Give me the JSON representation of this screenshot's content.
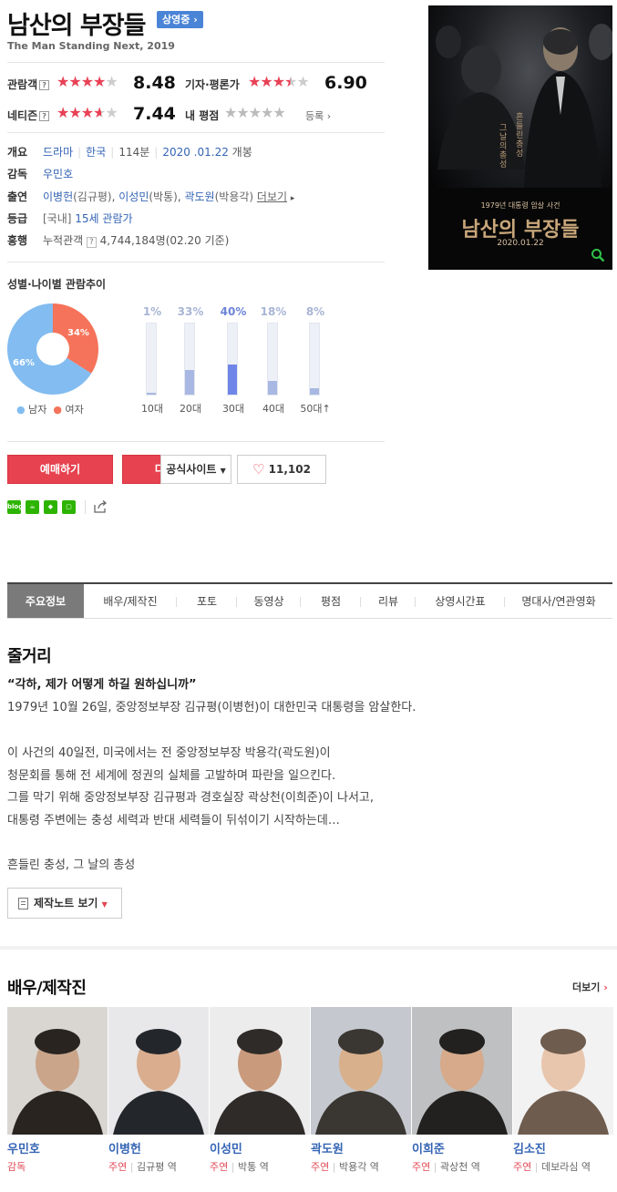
{
  "header": {
    "title": "남산의 부장들",
    "status_badge": "상영중",
    "subtitle": "The Man Standing Next, 2019"
  },
  "ratings": {
    "audience": {
      "label": "관람객",
      "help": "?",
      "stars": 4.2,
      "score": "8.48"
    },
    "critics": {
      "label": "기자·평론가",
      "stars": 3.5,
      "score": "6.90"
    },
    "netizen": {
      "label": "네티즌",
      "help": "?",
      "stars": 3.7,
      "score": "7.44"
    },
    "mine": {
      "label": "내 평점",
      "register": "등록"
    }
  },
  "info": {
    "overview_label": "개요",
    "genre": "드라마",
    "country": "한국",
    "runtime": "114분",
    "release_date": "2020 .01.22",
    "release_suffix": "개봉",
    "director_label": "감독",
    "director": "우민호",
    "cast_label": "출연",
    "cast1": "이병헌",
    "cast1_role": "(김규평)",
    "cast2": "이성민",
    "cast2_role": "(박통)",
    "cast3": "곽도원",
    "cast3_role": "(박용각)",
    "more": "더보기",
    "rating_label": "등급",
    "rating_prefix": "[국내]",
    "rating": "15세 관람가",
    "boxoffice_label": "흥행",
    "cumulative_label": "누적관객",
    "cumulative_help": "?",
    "cumulative_value": "4,744,184명(02.20 기준)"
  },
  "poster": {
    "tagline": "1979년 대통령 암살 사건",
    "title": "남산의 부장들",
    "date": "2020.01.22",
    "vertical_text_1": "흔들린 충성",
    "vertical_text_2": "그 날의 총성"
  },
  "audience_chart": {
    "title": "성별·나이별 관람추이",
    "gender": {
      "male_pct": 66,
      "female_pct": 34,
      "male_label_value": "66%",
      "female_label_value": "34%",
      "male_legend": "남자",
      "female_legend": "여자",
      "male_color": "#82bcf0",
      "female_color": "#f5735a"
    },
    "age": [
      {
        "label": "10대",
        "pct_text": "1%",
        "value": 1
      },
      {
        "label": "20대",
        "pct_text": "33%",
        "value": 33
      },
      {
        "label": "30대",
        "pct_text": "40%",
        "value": 40,
        "highlight": true
      },
      {
        "label": "40대",
        "pct_text": "18%",
        "value": 18
      },
      {
        "label": "50대↑",
        "pct_text": "8%",
        "value": 8
      }
    ]
  },
  "buttons": {
    "reserve": "예매하기",
    "download": "다운로드",
    "official_site": "공식사이트",
    "likes": "11,102"
  },
  "share": {
    "blog_label": "blog"
  },
  "tabs": [
    "주요정보",
    "배우/제작진",
    "포토",
    "동영상",
    "평점",
    "리뷰",
    "상영시간표",
    "명대사/연관영화"
  ],
  "synopsis": {
    "heading": "줄거리",
    "quote": "“각하, 제가 어떻게 하길 원하십니까”",
    "line1": "1979년 10월 26일, 중앙정보부장 김규평(이병헌)이 대한민국 대통령을 암살한다.",
    "line2": " 이 사건의 40일전, 미국에서는 전 중앙정보부장 박용각(곽도원)이",
    "line3": " 청문회를 통해 전 세계에 정권의 실체를 고발하며 파란을 일으킨다.",
    "line4": " 그를 막기 위해 중앙정보부장 김규평과 경호실장 곽상천(이희준)이 나서고,",
    "line5": " 대통령 주변에는 충성 세력과 반대 세력들이 뒤섞이기 시작하는데…",
    "line6": " 흔들린 충성, 그 날의 총성",
    "notes_button": "제작노트 보기"
  },
  "cast_section": {
    "heading": "배우/제작진",
    "more": "더보기",
    "people": [
      {
        "name": "우민호",
        "role": "감독",
        "character": ""
      },
      {
        "name": "이병헌",
        "role": "주연",
        "character": "김규평 역"
      },
      {
        "name": "이성민",
        "role": "주연",
        "character": "박통 역"
      },
      {
        "name": "곽도원",
        "role": "주연",
        "character": "박용각 역"
      },
      {
        "name": "이희준",
        "role": "주연",
        "character": "곽상천 역"
      },
      {
        "name": "김소진",
        "role": "주연",
        "character": "데보라심 역"
      }
    ]
  }
}
